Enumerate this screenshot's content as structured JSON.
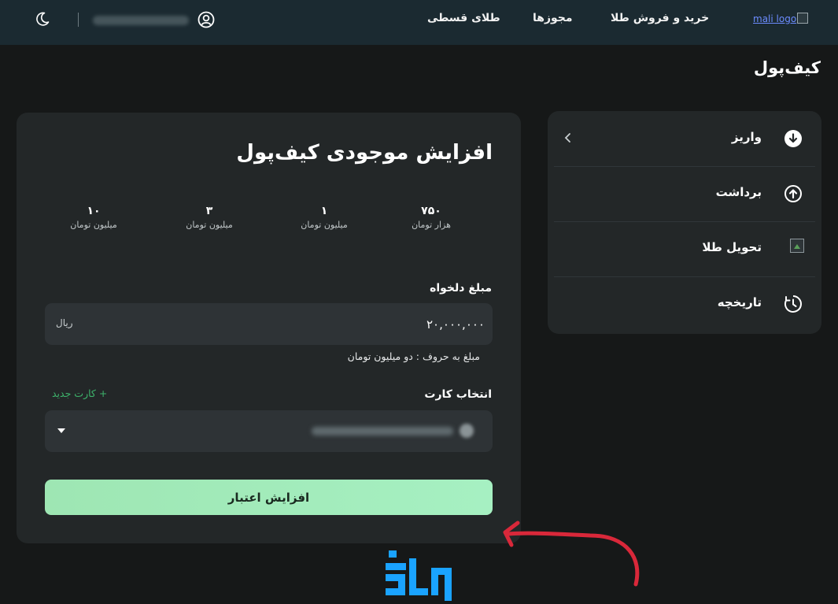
{
  "header": {
    "logo_alt": "mali logo",
    "nav": [
      "خرید و فروش طلا",
      "مجوزها",
      "طلای قسطی"
    ],
    "user_name_blurred": "",
    "icons": [
      "moon-icon",
      "user-icon"
    ]
  },
  "page": {
    "title": "کیف‌پول"
  },
  "sidebar": {
    "items": [
      {
        "label": "واریز",
        "icon": "download-icon"
      },
      {
        "label": "برداشت",
        "icon": "upload-icon"
      },
      {
        "label": "تحویل طلا",
        "icon": "broken-image-icon"
      },
      {
        "label": "تاریخچه",
        "icon": "history-icon"
      }
    ]
  },
  "wallet": {
    "title": "افزایش موجودی کیف‌پول",
    "presets": [
      {
        "value": "۷۵۰",
        "unit": "هزار تومان"
      },
      {
        "value": "۱",
        "unit": "میلیون تومان"
      },
      {
        "value": "۳",
        "unit": "میلیون تومان"
      },
      {
        "value": "۱۰",
        "unit": "میلیون تومان"
      }
    ],
    "amount_label": "مبلغ دلخواه",
    "amount_value": "۲۰,۰۰۰,۰۰۰",
    "amount_unit": "ریال",
    "amount_words": "مبلغ به حروف : دو میلیون تومان",
    "card_label": "انتخاب کارت",
    "new_card": "+ کارت جدید",
    "submit_label": "افزایش اعتبار"
  },
  "colors": {
    "background": "#161818",
    "header": "#1b2a31",
    "card": "#232728",
    "accent_green": "#3db36b",
    "button": "#a6f0c2",
    "annotation_red": "#d9283a",
    "watermark_blue": "#1aa3ff"
  }
}
